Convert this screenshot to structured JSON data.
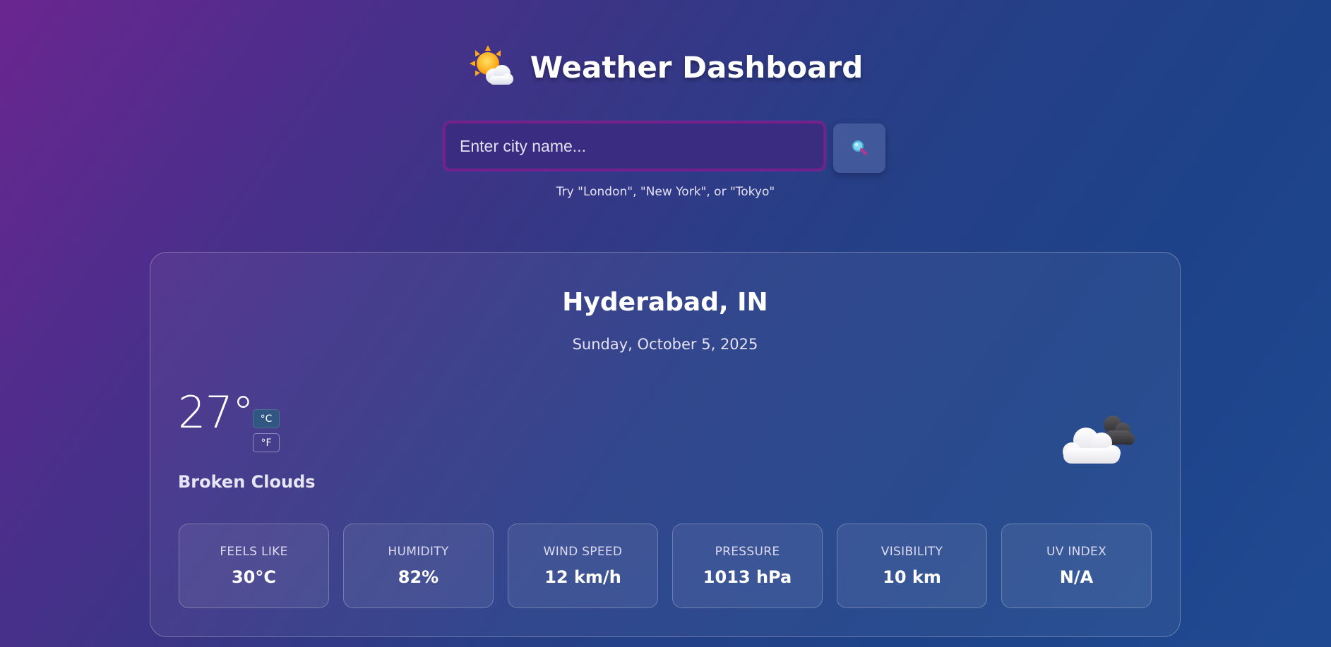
{
  "header": {
    "logo_icon": "sun-behind-cloud-icon",
    "title": "Weather Dashboard"
  },
  "search": {
    "placeholder": "Enter city name...",
    "value": "",
    "button_icon": "magnifying-glass-icon",
    "hint": "Try \"London\", \"New York\", or \"Tokyo\""
  },
  "current": {
    "location": "Hyderabad, IN",
    "date": "Sunday, October 5, 2025",
    "temperature": "27°",
    "unit_celsius": "°C",
    "unit_fahrenheit": "°F",
    "selected_unit": "°C",
    "condition": "Broken Clouds",
    "condition_icon": "broken-clouds-icon"
  },
  "stats": [
    {
      "label": "FEELS LIKE",
      "value": "30°C"
    },
    {
      "label": "HUMIDITY",
      "value": "82%"
    },
    {
      "label": "WIND SPEED",
      "value": "12 km/h"
    },
    {
      "label": "PRESSURE",
      "value": "1013 hPa"
    },
    {
      "label": "VISIBILITY",
      "value": "10 km"
    },
    {
      "label": "UV INDEX",
      "value": "N/A"
    }
  ],
  "colors": {
    "background_start": "#6a2690",
    "background_end": "#1f4a92",
    "input_border": "#7a1f8a",
    "celsius_active": "#285f7d"
  }
}
